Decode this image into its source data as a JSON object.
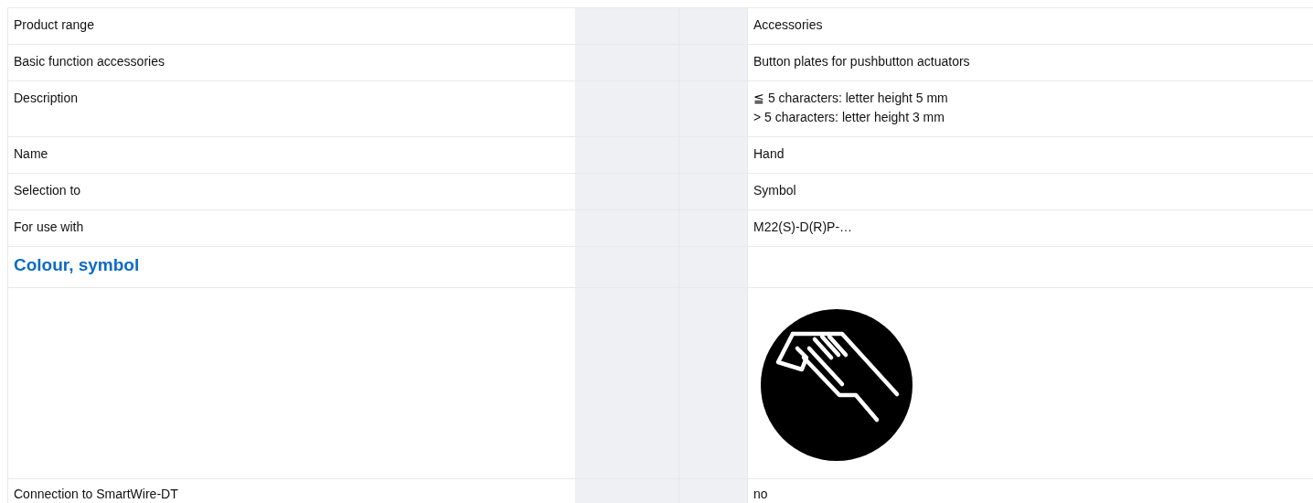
{
  "rows": [
    {
      "kind": "row",
      "label": "Product range",
      "value": [
        "Accessories"
      ]
    },
    {
      "kind": "row",
      "label": "Basic function accessories",
      "value": [
        "Button plates for pushbutton actuators"
      ]
    },
    {
      "kind": "row",
      "label": "Description",
      "value": [
        "≦ 5 characters: letter height 5 mm",
        "> 5 characters: letter height 3 mm"
      ]
    },
    {
      "kind": "row",
      "label": "Name",
      "value": [
        "Hand"
      ]
    },
    {
      "kind": "row",
      "label": "Selection to",
      "value": [
        "Symbol"
      ]
    },
    {
      "kind": "row",
      "label": "For use with",
      "value": [
        "M22(S)-D(R)P-…"
      ]
    },
    {
      "kind": "heading",
      "label": "Colour, symbol"
    },
    {
      "kind": "image"
    },
    {
      "kind": "row",
      "label": "Connection to SmartWire-DT",
      "value": [
        "no"
      ]
    }
  ]
}
